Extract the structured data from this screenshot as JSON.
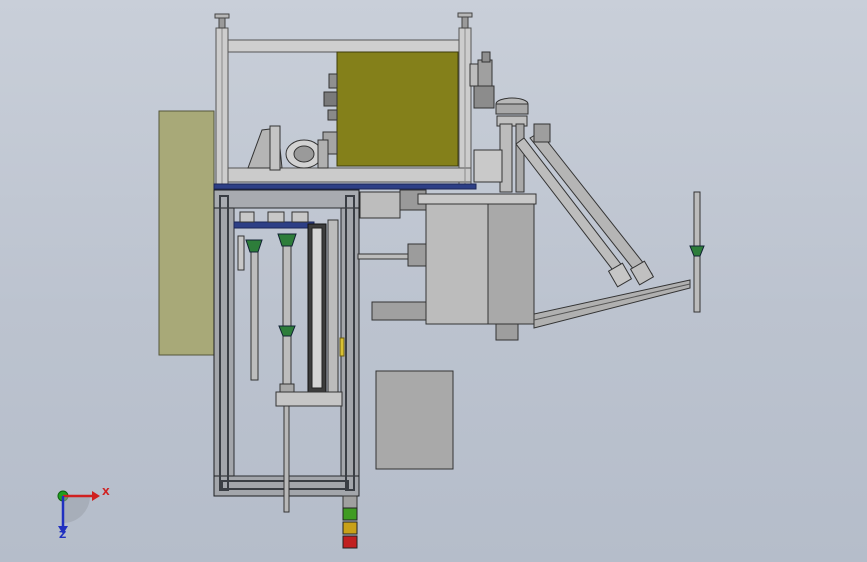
{
  "window": {
    "type": "cad-graphics-viewport",
    "background_top": "#c9cfd9",
    "background_bottom": "#b5bdca"
  },
  "triad": {
    "x_label": "X",
    "z_label": "Z",
    "x_color": "#d02020",
    "y_color": "#20a020",
    "z_color": "#2030c0"
  },
  "model": {
    "panel_yellow": "#84801a",
    "panel_khaki": "#a8a978",
    "frame_gray": "#c8c8c8",
    "steel_gray": "#a3a3a3",
    "dark_frame": "#3a3e44",
    "rail_blue": "#2d3f86",
    "stack_light": [
      "#3f9c22",
      "#c8a118",
      "#c01f1f"
    ]
  }
}
